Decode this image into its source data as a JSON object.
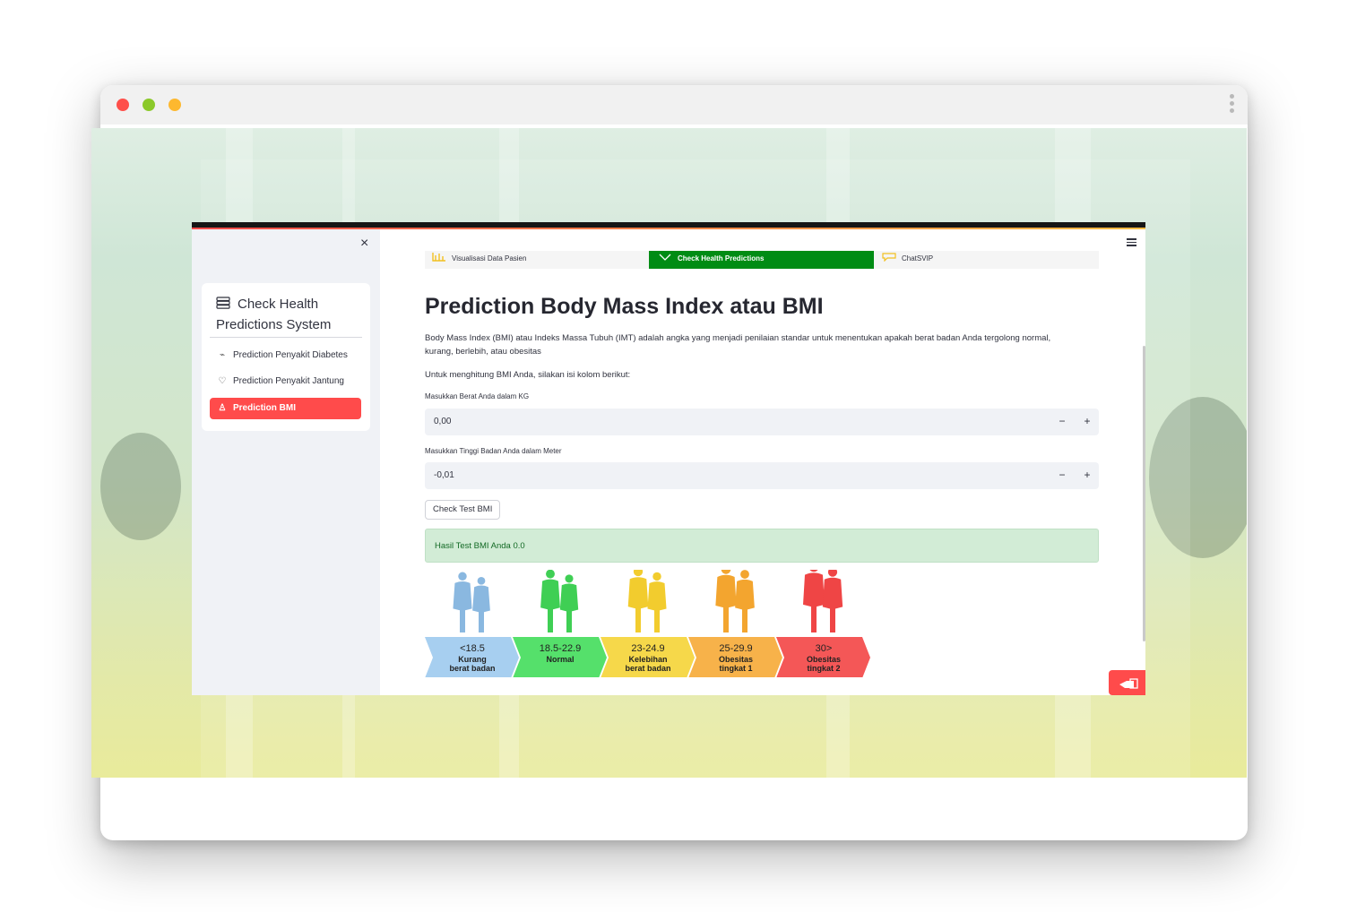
{
  "app": {
    "sidebar": {
      "title": "Check Health Predictions System",
      "items": [
        {
          "label": "Prediction Penyakit Diabetes",
          "icon": "activity-icon",
          "active": false
        },
        {
          "label": "Prediction Penyakit Jantung",
          "icon": "heart-icon",
          "active": false
        },
        {
          "label": "Prediction BMI",
          "icon": "person-icon",
          "active": true
        }
      ],
      "close_glyph": "×"
    },
    "nav": {
      "tabs": [
        {
          "label": "Visualisasi Data Pasien",
          "icon": "chart-icon",
          "active": false
        },
        {
          "label": "Check Health Predictions",
          "icon": "check-icon",
          "active": true
        },
        {
          "label": "ChatSVIP",
          "icon": "chat-icon",
          "active": false
        }
      ]
    },
    "main": {
      "title": "Prediction Body Mass Index atau BMI",
      "intro": "Body Mass Index (BMI) atau Indeks Massa Tubuh (IMT) adalah angka yang menjadi penilaian standar untuk menentukan apakah berat badan Anda tergolong normal, kurang, berlebih, atau obesitas",
      "instruction": "Untuk menghitung BMI Anda, silakan isi kolom berikut:",
      "weight": {
        "label": "Masukkan Berat Anda dalam KG",
        "value": "0,00"
      },
      "height": {
        "label": "Masukkan Tinggi Badan Anda dalam Meter",
        "value": "-0,01"
      },
      "stepper": {
        "minus": "−",
        "plus": "+"
      },
      "button": "Check Test BMI",
      "result": "Hasil Test BMI Anda 0.0",
      "bmi_categories": [
        {
          "range": "<18.5",
          "line1": "Kurang",
          "line2": "berat badan",
          "color": "#a7cff0",
          "figure_color": "#8ab8e0"
        },
        {
          "range": "18.5-22.9",
          "line1": "Normal",
          "line2": "",
          "color": "#55e06b",
          "figure_color": "#3fcf54"
        },
        {
          "range": "23-24.9",
          "line1": "Kelebihan",
          "line2": "berat badan",
          "color": "#f6d84a",
          "figure_color": "#f2cc2e"
        },
        {
          "range": "25-29.9",
          "line1": "Obesitas",
          "line2": "tingkat 1",
          "color": "#f7b24a",
          "figure_color": "#f3a52f"
        },
        {
          "range": "30>",
          "line1": "Obesitas",
          "line2": "tingkat 2",
          "color": "#f45757",
          "figure_color": "#ef4545"
        }
      ]
    }
  },
  "colors": {
    "accent": "#ff4b4b",
    "active_tab": "#008c14",
    "success_bg": "#d2ecd6"
  }
}
